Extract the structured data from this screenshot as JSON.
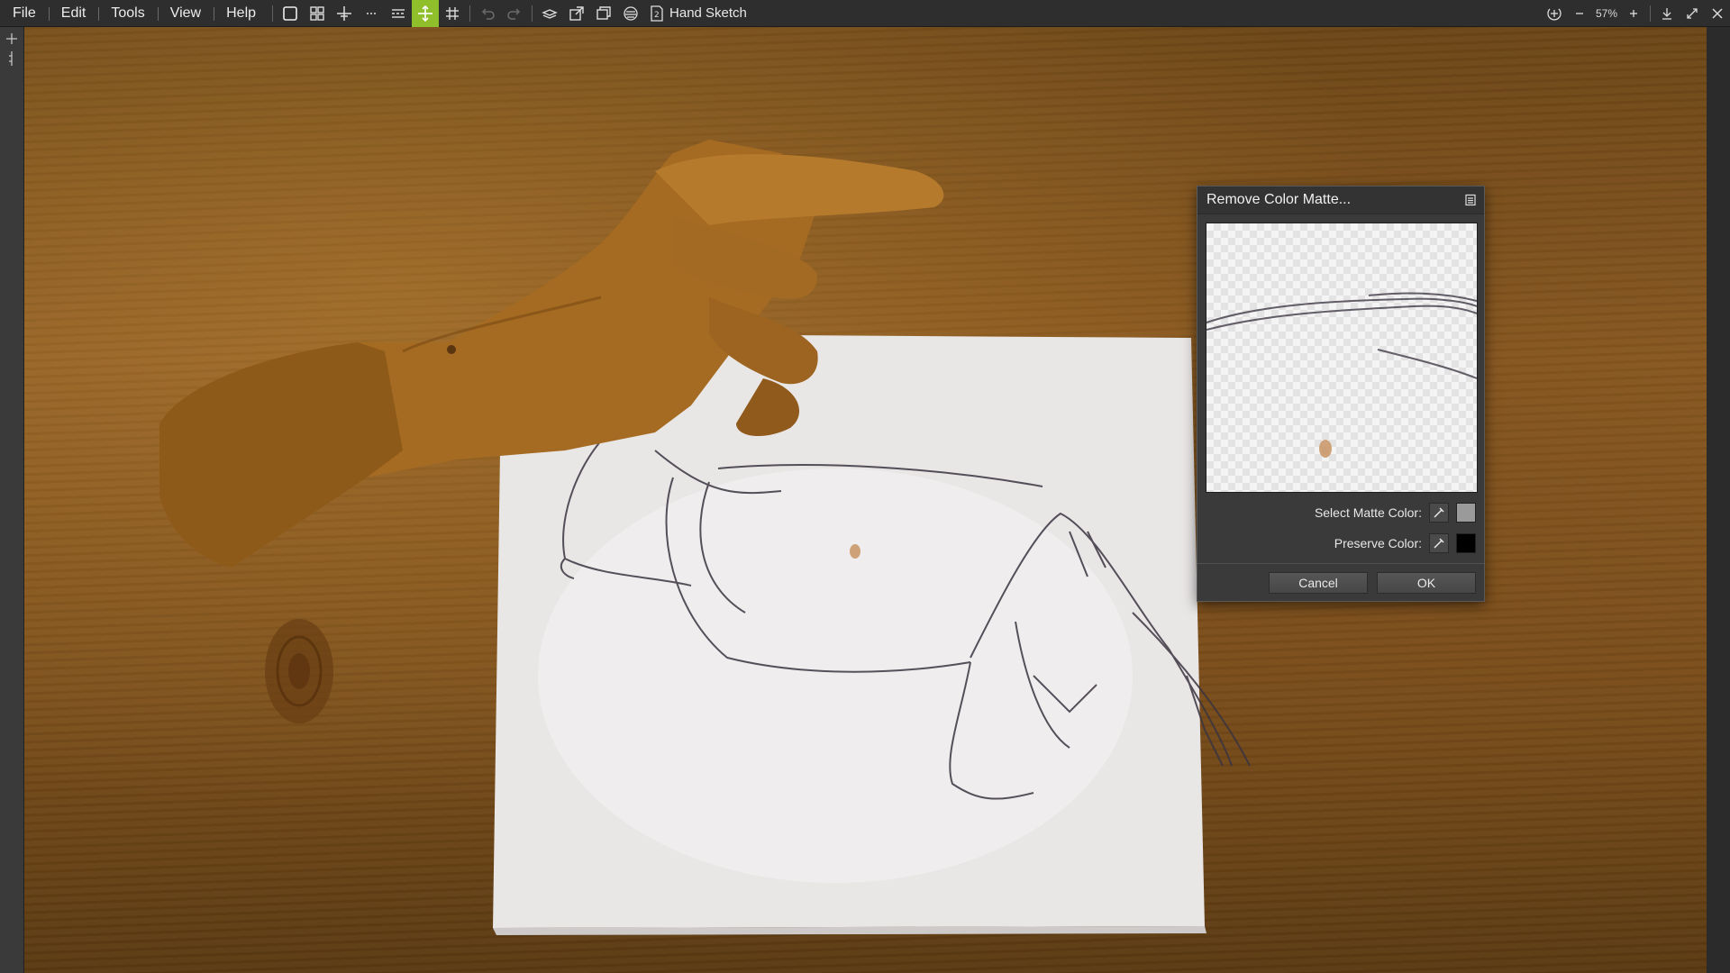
{
  "menu": {
    "file": "File",
    "edit": "Edit",
    "tools": "Tools",
    "view": "View",
    "help": "Help"
  },
  "document": {
    "title": "Hand Sketch"
  },
  "zoom": {
    "label": "57%"
  },
  "dialog": {
    "title": "Remove Color Matte...",
    "select_matte_label": "Select Matte Color:",
    "preserve_label": "Preserve Color:",
    "cancel_label": "Cancel",
    "ok_label": "OK",
    "matte_color": "#9a9a9a",
    "preserve_color": "#000000"
  },
  "colors": {
    "toolbar_bg": "#2e2e2e",
    "active_tool": "#8fbf2a",
    "dialog_bg": "#3a3a3a"
  },
  "icons": {
    "toolbar": [
      "new-doc-icon",
      "grid-icon",
      "crosshair-icon",
      "dash-icon",
      "align-icon",
      "move-icon",
      "hash-grid-icon",
      "undo-icon",
      "redo-icon",
      "layers-icon",
      "export-icon",
      "windows-icon",
      "filter-icon",
      "document-icon"
    ],
    "right": [
      "fit-icon",
      "zoom-out-icon",
      "zoom-in-icon",
      "download-icon",
      "fullscreen-icon",
      "close-icon"
    ]
  }
}
